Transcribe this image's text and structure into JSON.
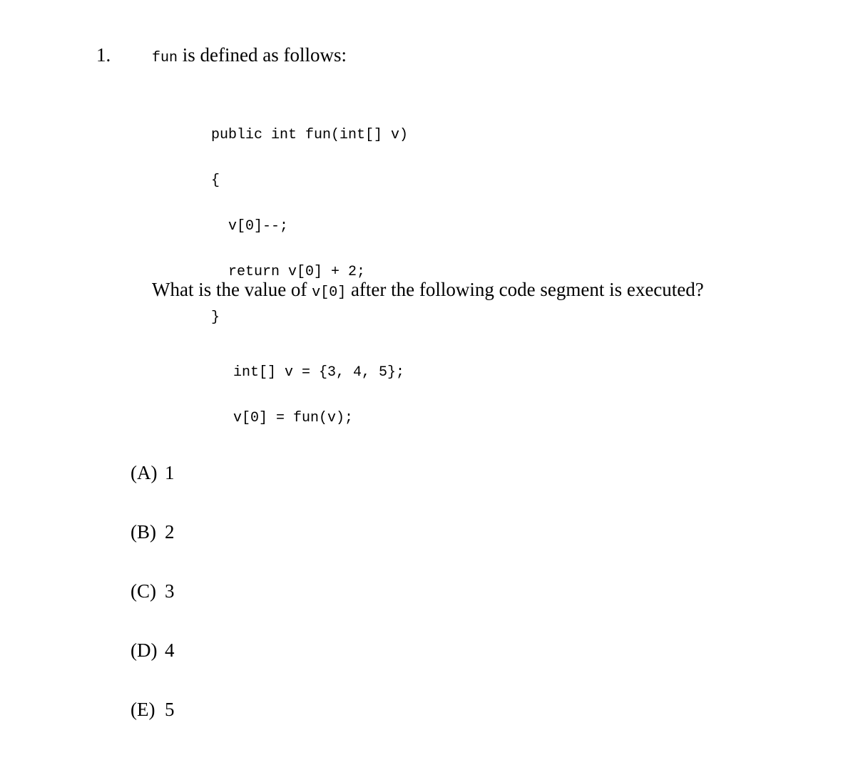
{
  "question": {
    "number": "1.",
    "intro_code": "fun",
    "intro_text": " is defined as follows:",
    "method_code": [
      "public int fun(int[] v)",
      "{",
      "  v[0]--;",
      "  return v[0] + 2;",
      "}"
    ],
    "prompt_before": "What is the value of ",
    "prompt_code": "v[0]",
    "prompt_after": " after the following code segment is executed?",
    "segment_code": [
      "int[] v = {3, 4, 5};",
      "v[0] = fun(v);"
    ],
    "choices": [
      {
        "letter": "(A)",
        "value": "1"
      },
      {
        "letter": "(B)",
        "value": "2"
      },
      {
        "letter": "(C)",
        "value": "3"
      },
      {
        "letter": "(D)",
        "value": "4"
      },
      {
        "letter": "(E)",
        "value": "5"
      }
    ]
  }
}
